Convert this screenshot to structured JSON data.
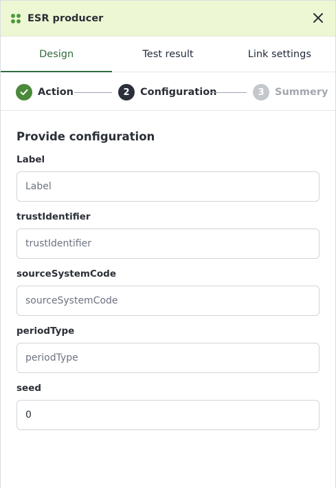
{
  "header": {
    "title": "ESR producer",
    "app_icon": "grid-dots-icon",
    "close_icon": "close-icon",
    "accent_color": "#eef7d4"
  },
  "tabs": [
    {
      "label": "Design",
      "active": true
    },
    {
      "label": "Test result",
      "active": false
    },
    {
      "label": "Link settings",
      "active": false
    }
  ],
  "stepper": {
    "steps": [
      {
        "number": "",
        "label": "Action",
        "state": "done"
      },
      {
        "number": "2",
        "label": "Configuration",
        "state": "current"
      },
      {
        "number": "3",
        "label": "Summery",
        "state": "pending"
      }
    ]
  },
  "form": {
    "title": "Provide configuration",
    "fields": [
      {
        "label": "Label",
        "placeholder": "Label",
        "value": ""
      },
      {
        "label": "trustIdentifier",
        "placeholder": "trustIdentifier",
        "value": ""
      },
      {
        "label": "sourceSystemCode",
        "placeholder": "sourceSystemCode",
        "value": ""
      },
      {
        "label": "periodType",
        "placeholder": "periodType",
        "value": ""
      },
      {
        "label": "seed",
        "placeholder": "",
        "value": "0"
      }
    ]
  }
}
